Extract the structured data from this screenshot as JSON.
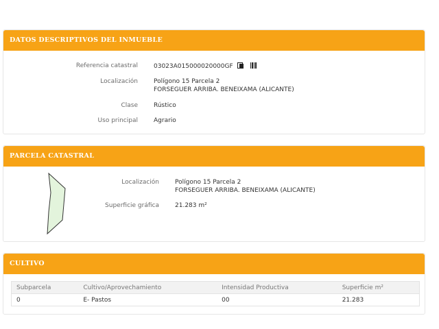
{
  "inmueble": {
    "header": "DATOS DESCRIPTIVOS DEL INMUEBLE",
    "referencia_label": "Referencia catastral",
    "referencia_value": "03023A015000020000GF",
    "localizacion_label": "Localización",
    "localizacion_line1": "Polígono 15 Parcela 2",
    "localizacion_line2": "FORSEGUER ARRIBA. BENEIXAMA (ALICANTE)",
    "clase_label": "Clase",
    "clase_value": "Rústico",
    "uso_label": "Uso principal",
    "uso_value": "Agrario",
    "icons": [
      "copy-icon",
      "barcode-icon"
    ]
  },
  "parcela": {
    "header": "PARCELA CATASTRAL",
    "localizacion_label": "Localización",
    "localizacion_line1": "Polígono 15 Parcela 2",
    "localizacion_line2": "FORSEGUER ARRIBA. BENEIXAMA (ALICANTE)",
    "superficie_label": "Superficie gráfica",
    "superficie_value": "21.283 m²",
    "plot_colors": {
      "fill": "#e3f4dc",
      "stroke": "#333333"
    }
  },
  "cultivo": {
    "header": "CULTIVO",
    "columns": [
      "Subparcela",
      "Cultivo/Aprovechamiento",
      "Intensidad Productiva",
      "Superficie m²"
    ],
    "rows": [
      [
        "0",
        "E- Pastos",
        "00",
        "21.283"
      ]
    ]
  },
  "colors": {
    "accent": "#f7a316",
    "border": "#e6e6e6"
  }
}
